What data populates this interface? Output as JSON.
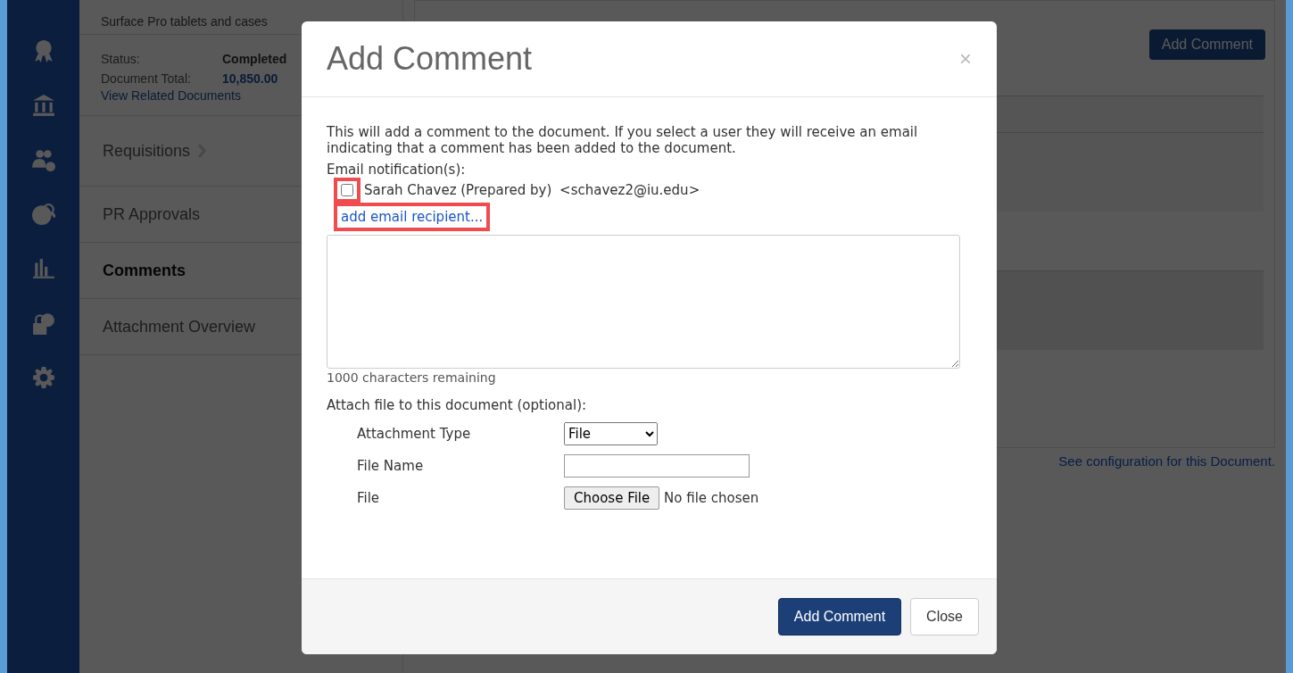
{
  "background": {
    "subtitle": "Surface Pro tablets and cases",
    "summary": [
      {
        "label": "Status:",
        "value": "Completed",
        "kind": "text"
      },
      {
        "label": "Document Total:",
        "value": "10,850.00",
        "kind": "amount"
      }
    ],
    "related_link": "View Related Documents",
    "nav": [
      {
        "label": "Requisitions",
        "chevron": true,
        "selected": false
      },
      {
        "label": "PR Approvals",
        "chevron": false,
        "selected": false
      },
      {
        "label": "Comments",
        "chevron": false,
        "selected": true
      },
      {
        "label": "Attachment Overview",
        "chevron": false,
        "selected": false
      }
    ],
    "add_button": "Add Comment",
    "config_link": "See configuration for this Document."
  },
  "dialog": {
    "title": "Add Comment",
    "close": "×",
    "description": "This will add a comment to the document. If you select a user they will receive an email indicating that a comment has been added to the document.",
    "notify_label": "Email notification(s):",
    "recipients": [
      {
        "label": "Sarah Chavez (Prepared by)",
        "email": "<schavez2@iu.edu>",
        "checked": false,
        "highlighted": true
      }
    ],
    "add_recipient": {
      "label": "add email recipient...",
      "highlighted": true
    },
    "remaining": "1000 characters remaining",
    "attach_label": "Attach file to this document (optional):",
    "fields": [
      {
        "label": "Attachment Type",
        "kind": "select",
        "value": "File"
      },
      {
        "label": "File Name",
        "kind": "text"
      },
      {
        "label": "File",
        "kind": "file",
        "button": "Choose File",
        "status": "No file chosen"
      }
    ],
    "buttons": [
      {
        "label": "Add Comment",
        "kind": "primary"
      },
      {
        "label": "Close",
        "kind": "secondary"
      }
    ]
  }
}
